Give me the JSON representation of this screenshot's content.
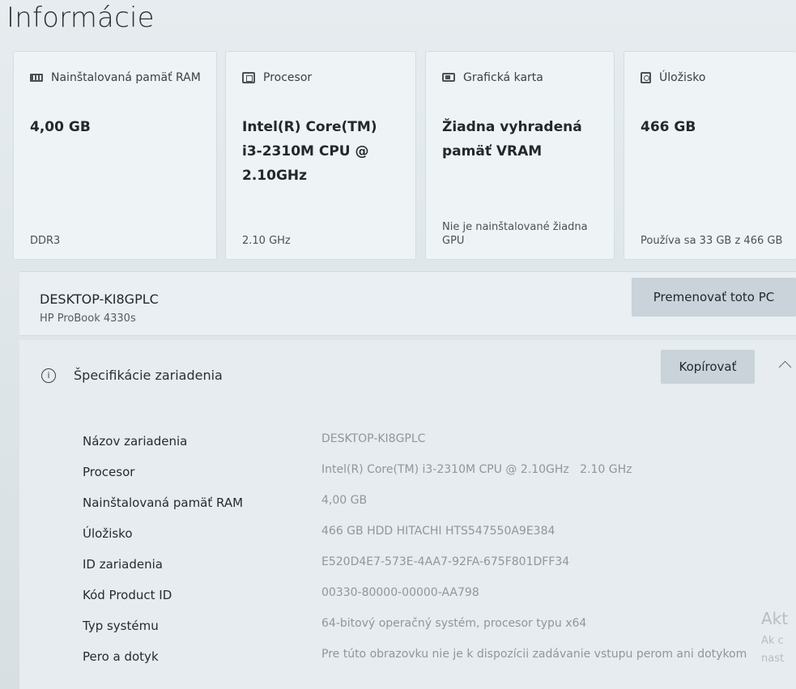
{
  "page": {
    "title": "Informácie"
  },
  "cards": [
    {
      "icon": "ram-icon",
      "label": "Nainštalovaná pamäť RAM",
      "value": "4,00 GB",
      "footer": "DDR3"
    },
    {
      "icon": "processor-icon",
      "label": "Procesor",
      "value": "Intel(R) Core(TM) i3-2310M CPU @ 2.10GHz",
      "footer": "2.10 GHz"
    },
    {
      "icon": "graphics-card-icon",
      "label": "Grafická karta",
      "value": "Žiadna vyhradená pamäť VRAM",
      "footer": "Nie je nainštalované žiadna GPU"
    },
    {
      "icon": "storage-icon",
      "label": "Úložisko",
      "value": "466 GB",
      "footer": "Používa sa 33 GB z 466 GB"
    }
  ],
  "pc": {
    "name": "DESKTOP-KI8GPLC",
    "model": "HP ProBook 4330s",
    "rename_label": "Premenovať toto PC"
  },
  "specs": {
    "title": "Špecifikácie zariadenia",
    "copy_label": "Kopírovať",
    "rows": [
      {
        "label": "Názov zariadenia",
        "value": "DESKTOP-KI8GPLC"
      },
      {
        "label": "Procesor",
        "value": "Intel(R) Core(TM) i3-2310M CPU @ 2.10GHz   2.10 GHz"
      },
      {
        "label": "Nainštalovaná pamäť RAM",
        "value": "4,00 GB"
      },
      {
        "label": "Úložisko",
        "value": "466 GB HDD HITACHI HTS547550A9E384"
      },
      {
        "label": "ID zariadenia",
        "value": "E520D4E7-573E-4AA7-92FA-675F801DFF34"
      },
      {
        "label": "Kód Product ID",
        "value": "00330-80000-00000-AA798"
      },
      {
        "label": "Typ systému",
        "value": "64-bitový operačný systém, procesor typu x64"
      },
      {
        "label": "Pero a dotyk",
        "value": "Pre túto obrazovku nie je k dispozícii zadávanie vstupu perom ani dotykom"
      }
    ]
  },
  "watermark": {
    "line1": "Akt",
    "line2": "Ak c",
    "line3": "nast"
  }
}
